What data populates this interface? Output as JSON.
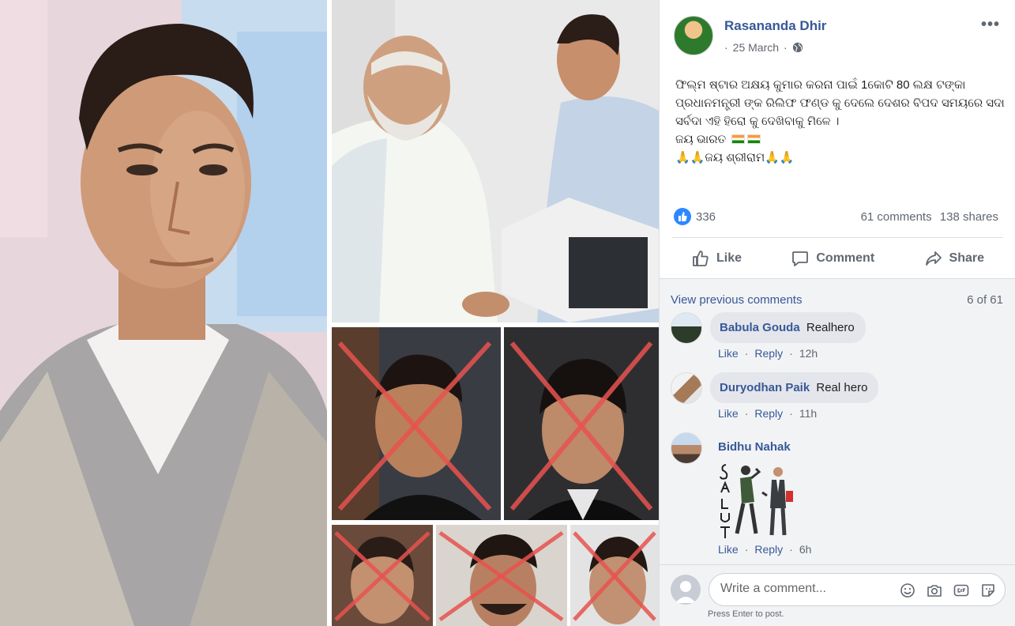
{
  "post": {
    "author": "Rasananda Dhir",
    "date": "25 March",
    "date_prefix": "·",
    "more": "•••",
    "text_lines": [
      "ଫିଲ୍ମ ଷ୍ଟାର ଅକ୍ଷୟ କୁମାର କରନା ପାଇଁ 1କୋଟି 80 ଲକ୍ଷ ଟଙ୍କା",
      "ପ୍ରଧାନମନ୍ତ୍ରୀ ଙ୍କ ରିଲିଫ ଫଣ୍ଡ କୁ ଦେଲେ ଦେଶର ବିପଦ ସମୟରେ ସଦା",
      "ସର୍ବଦା ଏହି ହିରୋ କୁ ଦେଖିବାକୁ ମିଳେ ।",
      "ଜୟ ଭାରତ",
      "🙏🙏ଜୟ ଶ୍ରୀରାମ🙏🙏"
    ],
    "reactions_count": "336",
    "comments_count": "61 comments",
    "shares_count": "138 shares"
  },
  "actions": {
    "like": "Like",
    "comment": "Comment",
    "share": "Share"
  },
  "comments_section": {
    "view_previous": "View previous comments",
    "page_count": "6 of 61",
    "items": [
      {
        "name": "Babula Gouda",
        "text": "Realhero",
        "like": "Like",
        "reply": "Reply",
        "time": "12h"
      },
      {
        "name": "Duryodhan Paik",
        "text": "Real hero",
        "like": "Like",
        "reply": "Reply",
        "time": "11h"
      },
      {
        "name": "Bidhu Nahak",
        "text": "",
        "like": "Like",
        "reply": "Reply",
        "time": "6h",
        "image_caption": "SALUTE"
      }
    ]
  },
  "composer": {
    "placeholder": "Write a comment...",
    "hint": "Press Enter to post."
  },
  "colors": {
    "link_blue": "#385898",
    "like_blue": "#2d88ff",
    "gray_text": "#606770",
    "cross_red": "#e8534f"
  }
}
